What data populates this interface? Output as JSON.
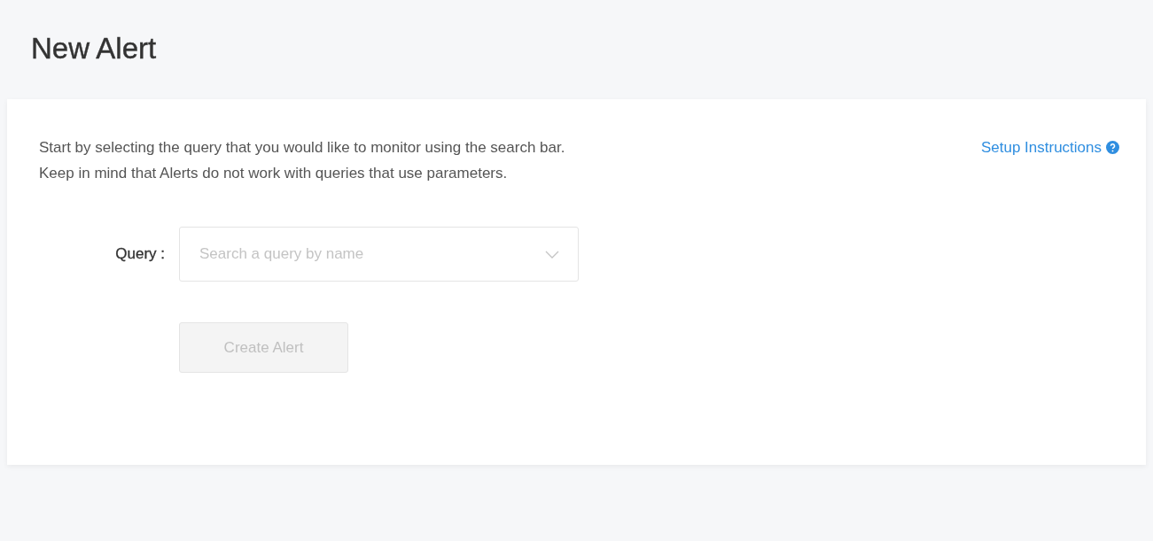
{
  "page": {
    "title": "New Alert"
  },
  "intro": {
    "lines": [
      "Start by selecting the query that you would like to monitor using the search bar.",
      "Keep in mind that Alerts do not work with queries that use parameters."
    ],
    "link": "Setup Instructions"
  },
  "form": {
    "query_label": "Query :",
    "query_field": {
      "placeholder": "Search a query by name"
    },
    "create_button": {
      "label": "Create Alert",
      "disabled": true
    }
  }
}
